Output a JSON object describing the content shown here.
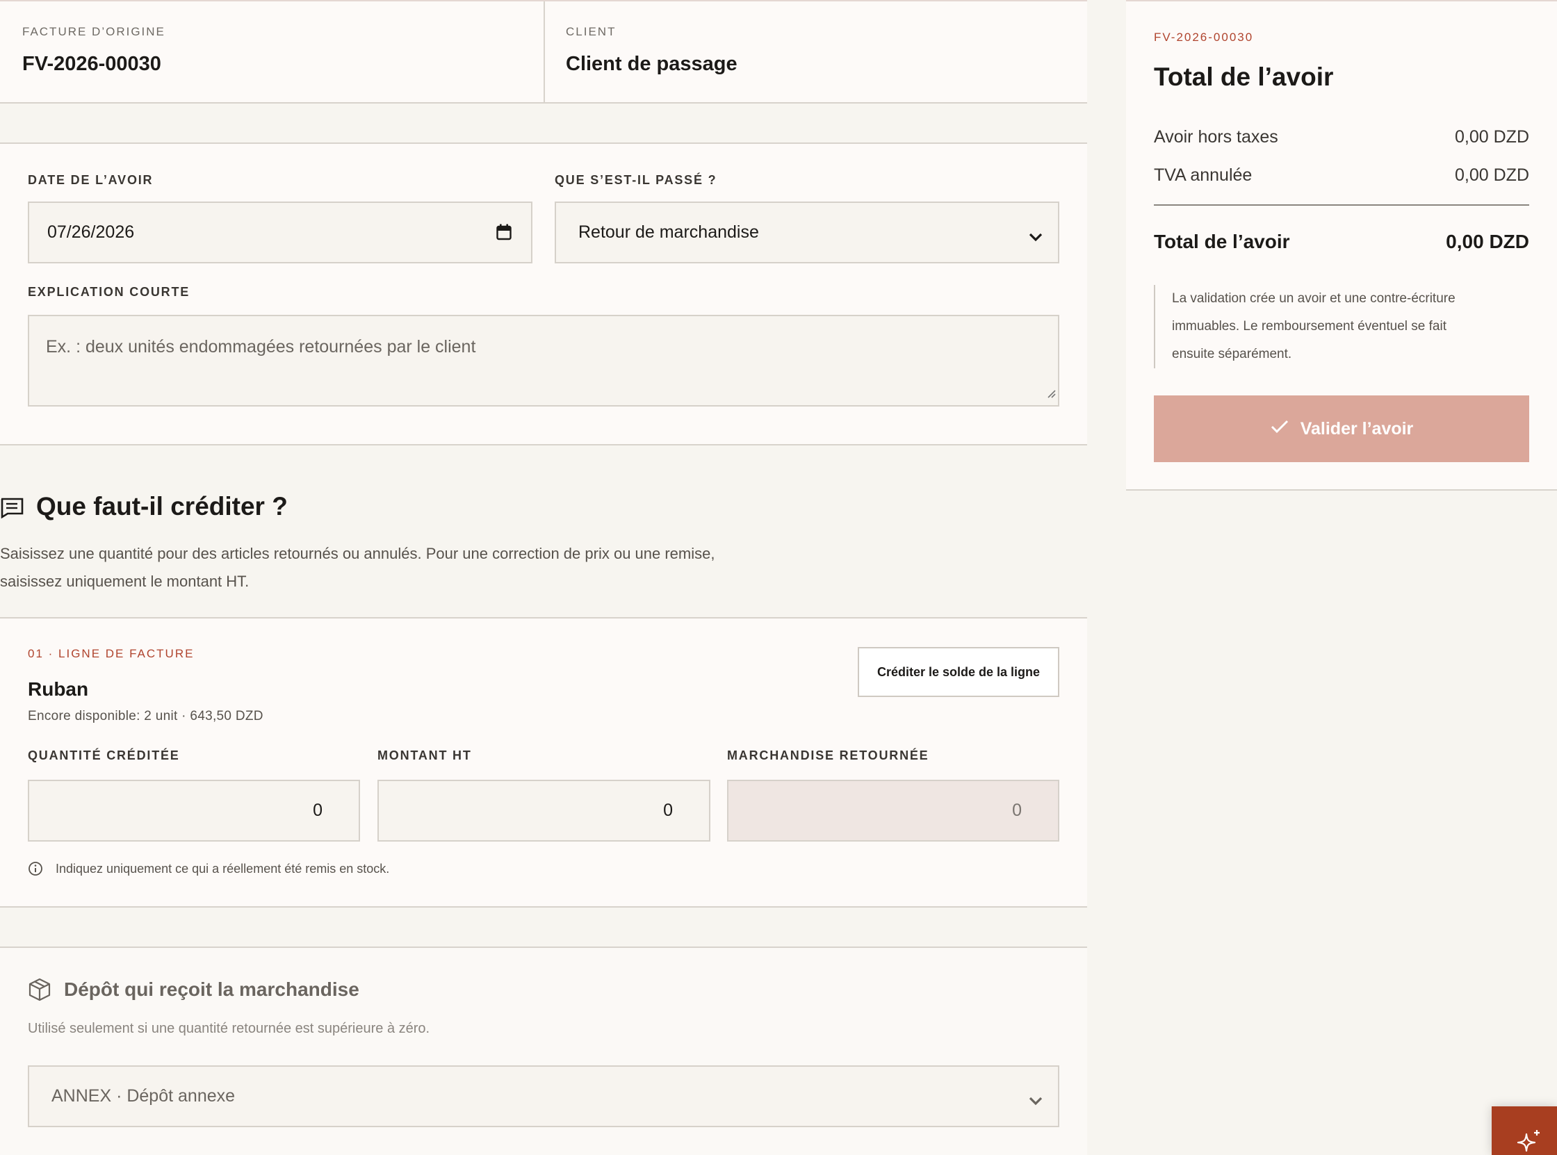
{
  "invoice": {
    "origin_label": "FACTURE D’ORIGINE",
    "origin_value": "FV-2026-00030",
    "client_label": "CLIENT",
    "client_value": "Client de passage"
  },
  "form": {
    "date_label": "DATE DE L’AVOIR",
    "date_value": "07/26/2026",
    "reason_label": "QUE S’EST-IL PASSÉ ?",
    "reason_value": "Retour de marchandise",
    "explanation_label": "EXPLICATION COURTE",
    "explanation_placeholder": "Ex. : deux unités endommagées retournées par le client"
  },
  "credit_section": {
    "title": "Que faut-il créditer ?",
    "description_line1": "Saisissez une quantité pour des articles retournés ou annulés. Pour une correction de prix ou une remise,",
    "description_line2": "saisissez uniquement le montant HT."
  },
  "line": {
    "index_label": "01 · LIGNE DE FACTURE",
    "product_name": "Ruban",
    "available": "Encore disponible: 2 unit · 643,50 DZD",
    "credit_balance_button": "Créditer le solde de la ligne",
    "qty_label": "QUANTITÉ CRÉDITÉE",
    "qty_value": "0",
    "amount_label": "MONTANT HT",
    "amount_value": "0",
    "returned_label": "MARCHANDISE RETOURNÉE",
    "returned_value": "0",
    "hint": "Indiquez uniquement ce qui a réellement été remis en stock."
  },
  "depot": {
    "title": "Dépôt qui reçoit la marchandise",
    "description": "Utilisé seulement si une quantité retournée est supérieure à zéro.",
    "selected": "ANNEX · Dépôt annexe"
  },
  "summary": {
    "invoice_ref": "FV-2026-00030",
    "title": "Total de l’avoir",
    "ht_label": "Avoir hors taxes",
    "ht_value": "0,00 DZD",
    "tva_label": "TVA annulée",
    "tva_value": "0,00 DZD",
    "total_label": "Total de l’avoir",
    "total_value": "0,00 DZD",
    "note_line1": "La validation crée un avoir et une contre-écriture",
    "note_line2": "immuables. Le remboursement éventuel se fait",
    "note_line3": "ensuite séparément.",
    "validate_button": "Valider l’avoir"
  },
  "colors": {
    "accent": "#b0442e",
    "button_disabled": "#dba79a",
    "fab": "#a83e20"
  },
  "icons": [
    "calendar-icon",
    "chevron-down-icon",
    "receipt-icon",
    "info-icon",
    "package-icon",
    "check-icon",
    "sparkles-icon"
  ]
}
